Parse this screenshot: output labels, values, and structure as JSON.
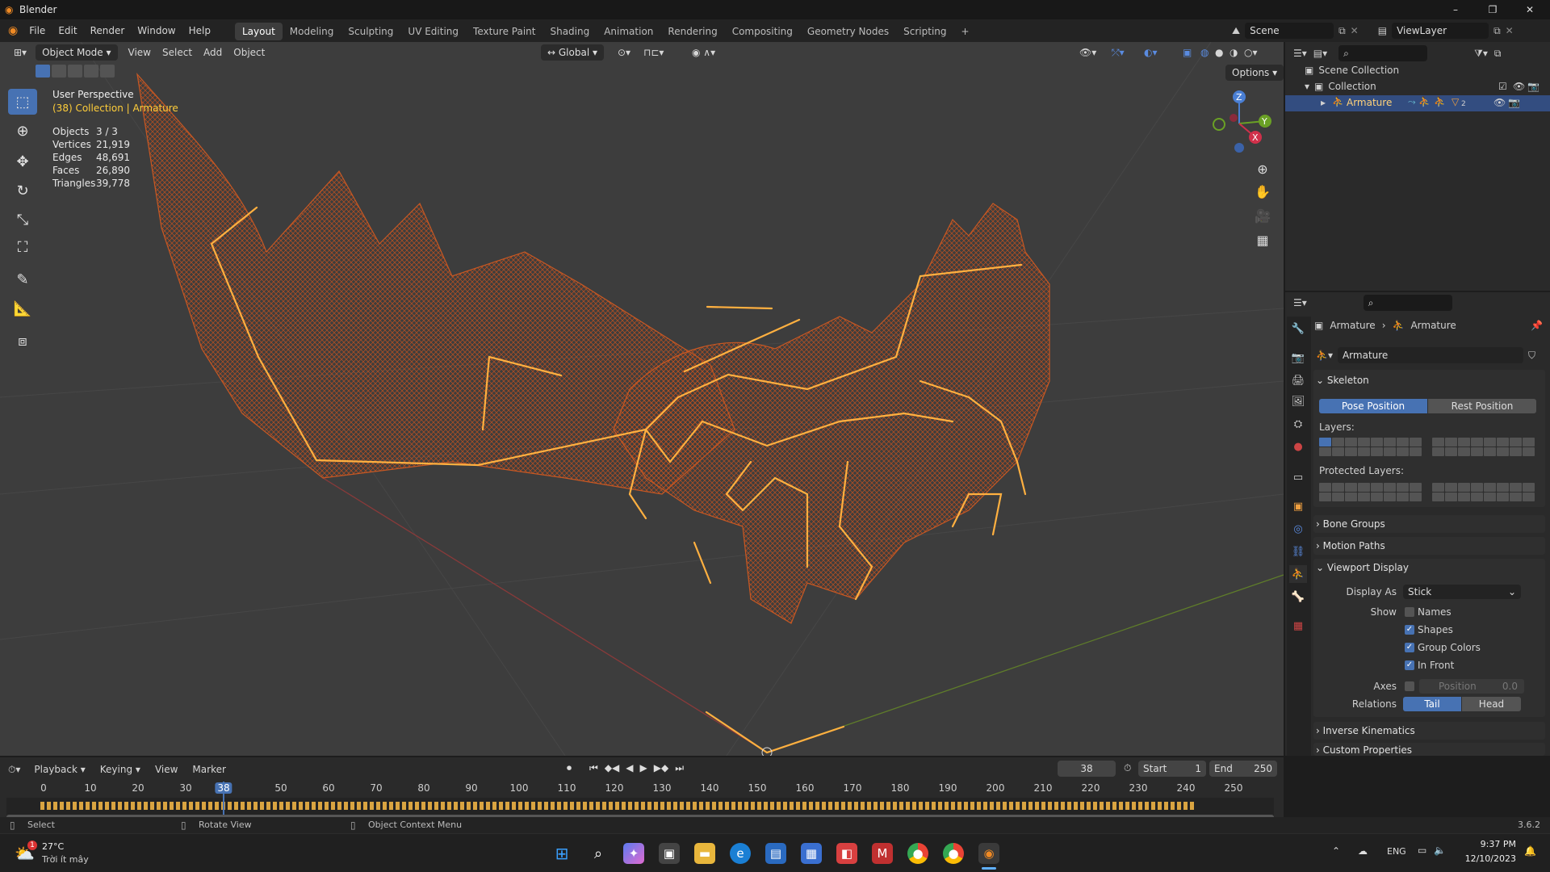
{
  "window": {
    "title": "Blender",
    "minimize": "–",
    "maximize": "❐",
    "close": "✕"
  },
  "menu": [
    "File",
    "Edit",
    "Render",
    "Window",
    "Help"
  ],
  "workspaces": [
    "Layout",
    "Modeling",
    "Sculpting",
    "UV Editing",
    "Texture Paint",
    "Shading",
    "Animation",
    "Rendering",
    "Compositing",
    "Geometry Nodes",
    "Scripting",
    "+"
  ],
  "scene": {
    "scene_label": "Scene",
    "viewlayer_label": "ViewLayer"
  },
  "viewport": {
    "mode": "Object Mode",
    "menus": [
      "View",
      "Select",
      "Add",
      "Object"
    ],
    "orientation": "Global",
    "options": "Options",
    "overlay_title": "User Perspective",
    "overlay_sub": "(38) Collection | Armature",
    "stats": [
      [
        "Objects",
        "3 / 3"
      ],
      [
        "Vertices",
        "21,919"
      ],
      [
        "Edges",
        "48,691"
      ],
      [
        "Faces",
        "26,890"
      ],
      [
        "Triangles",
        "39,778"
      ]
    ],
    "gizmo": {
      "x": "X",
      "y": "Y",
      "z": "Z"
    }
  },
  "outliner": {
    "root": "Scene Collection",
    "collection": "Collection",
    "object": "Armature",
    "constraint_count": "2"
  },
  "properties": {
    "breadcrumb": [
      "Armature",
      "Armature"
    ],
    "datablock": "Armature",
    "skeleton": "Skeleton",
    "pose_position": "Pose Position",
    "rest_position": "Rest Position",
    "layers": "Layers:",
    "protected_layers": "Protected Layers:",
    "bone_groups": "Bone Groups",
    "motion_paths": "Motion Paths",
    "viewport_display": "Viewport Display",
    "display_as_label": "Display As",
    "display_as_value": "Stick",
    "show_label": "Show",
    "names": "Names",
    "shapes": "Shapes",
    "group_colors": "Group Colors",
    "in_front": "In Front",
    "axes_label": "Axes",
    "position_label": "Position",
    "position_value": "0.0",
    "relations_label": "Relations",
    "tail": "Tail",
    "head": "Head",
    "inverse_kinematics": "Inverse Kinematics",
    "custom_properties": "Custom Properties"
  },
  "timeline": {
    "menus": [
      "Playback",
      "Keying",
      "View",
      "Marker"
    ],
    "current_frame": "38",
    "start_label": "Start",
    "start": "1",
    "end_label": "End",
    "end": "250",
    "ticks": [
      "0",
      "10",
      "20",
      "30",
      "38",
      "50",
      "60",
      "70",
      "80",
      "90",
      "100",
      "110",
      "120",
      "130",
      "140",
      "150",
      "160",
      "170",
      "180",
      "190",
      "200",
      "210",
      "220",
      "230",
      "240",
      "250"
    ]
  },
  "statusbar": {
    "select": "Select",
    "rotate": "Rotate View",
    "context": "Object Context Menu",
    "version": "3.6.2"
  },
  "taskbar": {
    "temp": "27°C",
    "weather": "Trời ít mây",
    "lang": "ENG",
    "time": "9:37 PM",
    "date": "12/10/2023",
    "badge": "1"
  },
  "colors": {
    "accent": "#4772b3",
    "bone": "#ffb040",
    "mesh": "#c4521e",
    "bg": "#3d3d3d"
  }
}
